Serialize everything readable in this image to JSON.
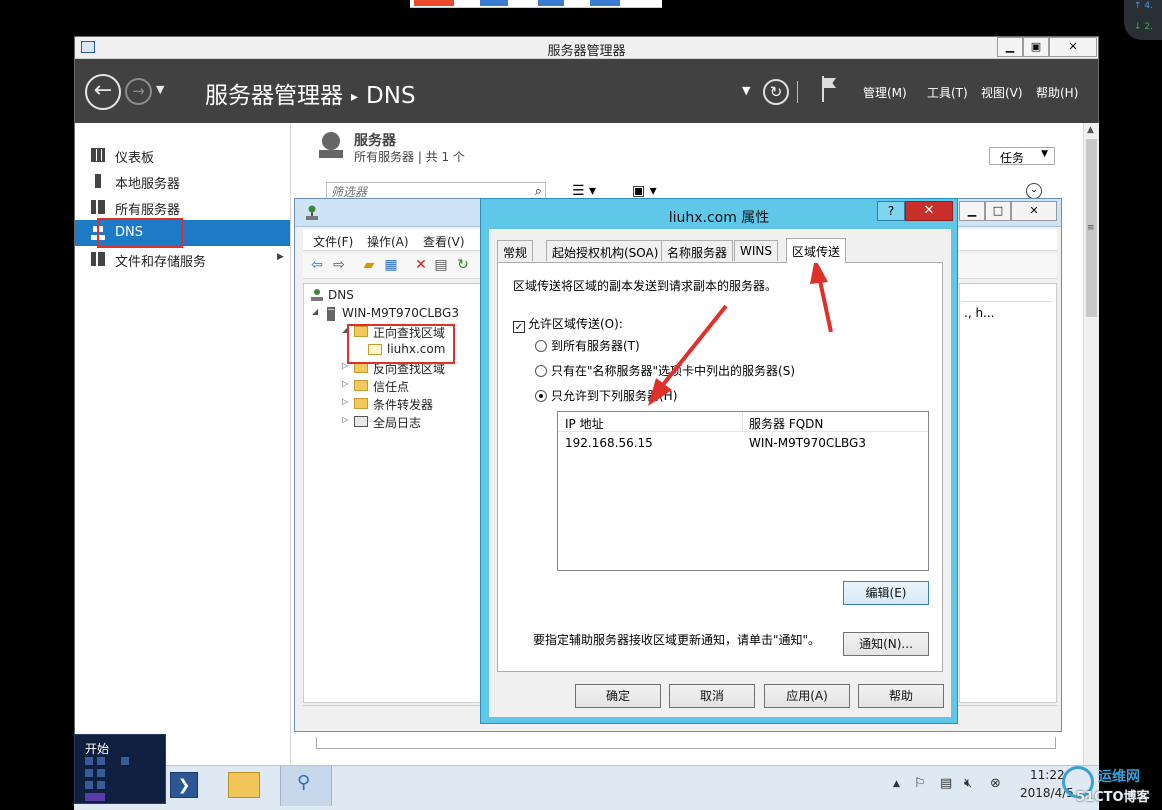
{
  "server_manager": {
    "window_title": "服务器管理器",
    "window_controls": {
      "minimize": "▁",
      "maximize": "▣",
      "close": "✕"
    },
    "nav_back": "←",
    "nav_forward": "→",
    "breadcrumb": {
      "root": "服务器管理器",
      "separator": "▸",
      "current": "DNS"
    },
    "header_menu": {
      "manage": "管理(M)",
      "tools": "工具(T)",
      "view": "视图(V)",
      "help": "帮助(H)"
    },
    "sidebar": {
      "items": [
        {
          "label": "仪表板",
          "icon": "dashboard-icon"
        },
        {
          "label": "本地服务器",
          "icon": "local-server-icon"
        },
        {
          "label": "所有服务器",
          "icon": "all-servers-icon"
        },
        {
          "label": "DNS",
          "icon": "dns-icon",
          "selected": true
        },
        {
          "label": "文件和存储服务",
          "icon": "file-storage-icon"
        }
      ]
    },
    "servers_section": {
      "title": "服务器",
      "subtitle": "所有服务器 | 共 1 个",
      "tasks_label": "任务",
      "filter_placeholder": "筛选器"
    }
  },
  "dns_manager": {
    "menu": {
      "file": "文件(F)",
      "action": "操作(A)",
      "view": "查看(V)"
    },
    "tree": {
      "root": "DNS",
      "server": "WIN-M9T970CLBG3",
      "forward_zones": "正向查找区域",
      "zone": "liuhx.com",
      "reverse_zones": "反向查找区域",
      "trust_points": "信任点",
      "conditional_forwarders": "条件转发器",
      "global_logs": "全局日志"
    },
    "right_pane_text": "., h..."
  },
  "properties_dialog": {
    "title": "liuhx.com 属性",
    "help_button": "?",
    "close_button": "✕",
    "tabs": [
      "常规",
      "起始授权机构(SOA)",
      "名称服务器",
      "WINS",
      "区域传送"
    ],
    "active_tab": "区域传送",
    "description": "区域传送将区域的副本发送到请求副本的服务器。",
    "allow_transfer_label": "允许区域传送(O):",
    "allow_transfer_checked": true,
    "radio_all": "到所有服务器(T)",
    "radio_ns": "只有在\"名称服务器\"选项卡中列出的服务器(S)",
    "radio_list": "只允许到下列服务器(H)",
    "radio_selected": "radio_list",
    "table": {
      "headers": [
        "IP 地址",
        "服务器 FQDN"
      ],
      "rows": [
        [
          "192.168.56.15",
          "WIN-M9T970CLBG3"
        ]
      ]
    },
    "edit_button": "编辑(E)",
    "notify_text": "要指定辅助服务器接收区域更新通知，请单击\"通知\"。",
    "notify_button": "通知(N)...",
    "ok_button": "确定",
    "cancel_button": "取消",
    "apply_button": "应用(A)",
    "help_bottom_button": "帮助"
  },
  "taskbar": {
    "start_label": "开始",
    "clock_time": "11:22",
    "clock_date": "2018/4/5",
    "tray_up": "▲"
  },
  "watermark": {
    "line1": "运维网",
    "line2": "51CTO博客"
  },
  "corner_widget": {
    "up": "↑ 4.",
    "down": "↓ 2."
  },
  "colors": {
    "header_bg": "#414141",
    "nav_selected": "#1c7ac7",
    "dialog_frame": "#5fc8e9",
    "annotation_red": "#e0302a"
  }
}
